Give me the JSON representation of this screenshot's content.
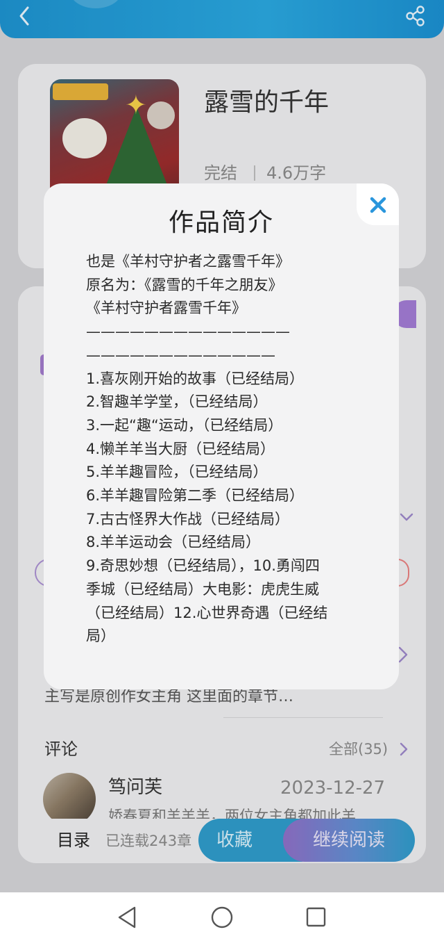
{
  "colors": {
    "header": "#1d92cf",
    "accent_purple": "#a17bd3",
    "close_blue": "#2a96dc",
    "collect_button": "#2f9bc9"
  },
  "header": {
    "back_icon": "chevron-left",
    "share_icon": "share"
  },
  "book": {
    "title": "露雪的千年",
    "status": "完结",
    "word_count": "4.6万字"
  },
  "description_snippet": "主写是原创作女主角 这里面的章节…",
  "comments": {
    "title": "评论",
    "all_label": "全部(35)",
    "first": {
      "user": "笃问芙",
      "date": "2023-12-27",
      "text": "娇春夏和羊羊羊，两位女主角都加此羊"
    }
  },
  "bottom_bar": {
    "toc_label": "目录",
    "serial_label": "已连载243章",
    "collect_label": "收藏",
    "continue_label": "继续阅读"
  },
  "modal": {
    "title": "作品简介",
    "close_icon": "close-x",
    "lines": [
      "也是《羊村守护者之露雪千年》",
      "原名为：《露雪的千年之朋友》",
      "《羊村守护者露雪千年》",
      "——————————————",
      "—————————————",
      "1.喜灰刚开始的故事（已经结局）",
      "2.智趣羊学堂，（已经结局）",
      "3.一起“趣“运动，（已经结局）",
      "4.懒羊羊当大厨（已经结局）",
      "5.羊羊趣冒险，（已经结局）",
      "6.羊羊趣冒险第二季（已经结局）",
      "7.古古怪界大作战（已经结局）",
      "8.羊羊运动会（已经结局）",
      "9.奇思妙想（已经结局），10.勇闯四",
      "季城（已经结局）大电影：虎虎生威",
      "（已经结局）12.心世界奇遇（已经结",
      "局）"
    ]
  },
  "system_nav": {
    "back": "triangle-back",
    "home": "circle-home",
    "recents": "square-recents"
  }
}
